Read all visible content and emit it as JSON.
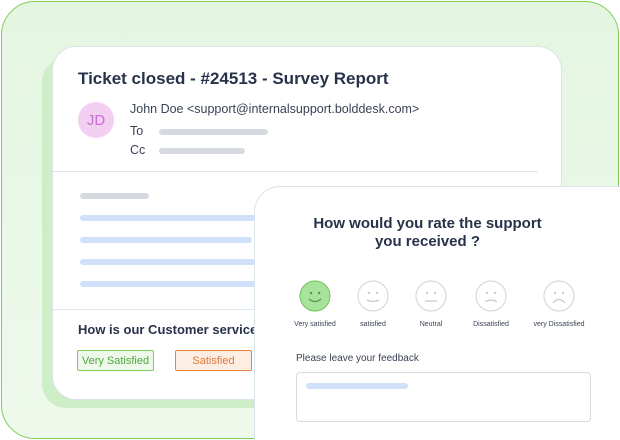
{
  "email": {
    "title": "Ticket closed - #24513 - Survey Report",
    "avatar_initials": "JD",
    "from": "John Doe <support@internalsupport.bolddesk.com>",
    "to_label": "To",
    "cc_label": "Cc",
    "question": "How is our Customer service ?",
    "options": [
      "Very Satisfied",
      "Satisfied"
    ]
  },
  "survey": {
    "title_line1": "How would you rate the support",
    "title_line2": "you received ?",
    "ratings": [
      {
        "label": "Very satisfied",
        "icon": "very-happy-face-icon",
        "selected": true
      },
      {
        "label": "satisfied",
        "icon": "happy-face-icon",
        "selected": false
      },
      {
        "label": "Neutral",
        "icon": "neutral-face-icon",
        "selected": false
      },
      {
        "label": "Dissatisfied",
        "icon": "sad-face-icon",
        "selected": false
      },
      {
        "label": "very Dissatisfied",
        "icon": "very-sad-face-icon",
        "selected": false
      }
    ],
    "feedback_label": "Please leave your feedback"
  },
  "colors": {
    "accent_green": "#7ccf55",
    "selected_fill": "#a8e29b",
    "orange": "#e9843f"
  }
}
